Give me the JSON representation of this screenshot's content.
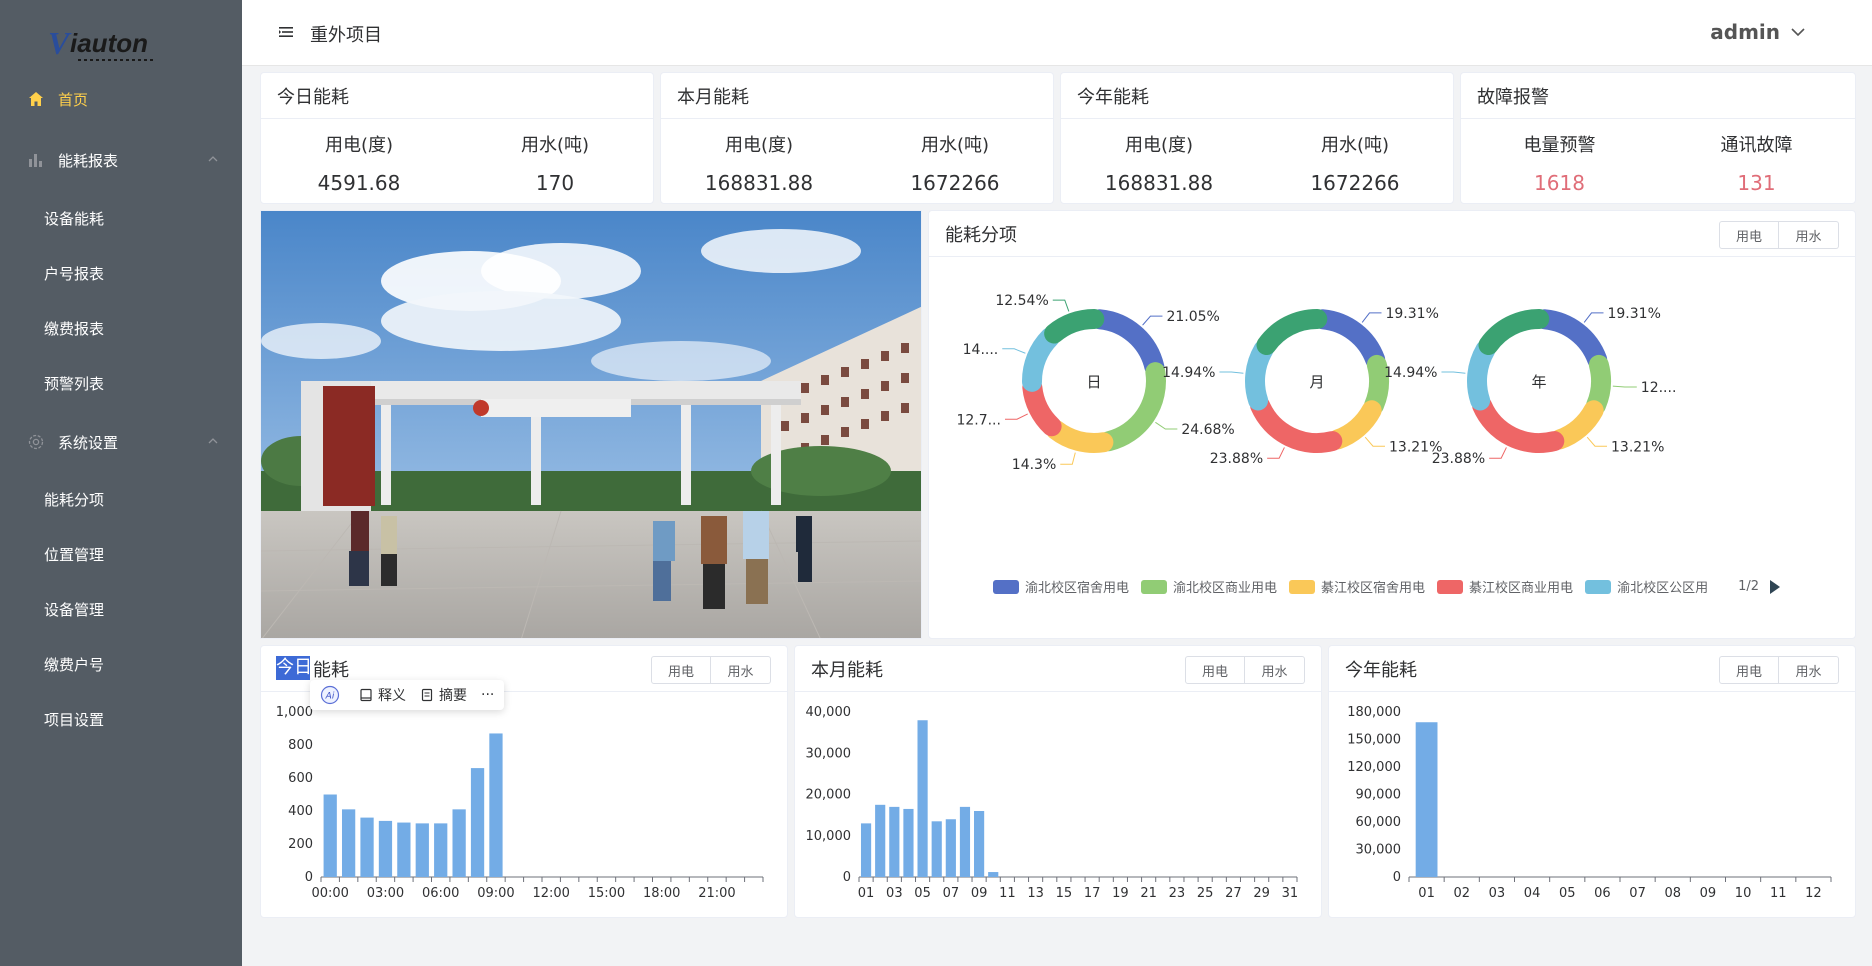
{
  "brand": {
    "logo_text": "Viauton"
  },
  "sidebar": {
    "home": "首页",
    "reports": {
      "label": "能耗报表",
      "items": [
        "设备能耗",
        "户号报表",
        "缴费报表",
        "预警列表"
      ]
    },
    "settings": {
      "label": "系统设置",
      "items": [
        "能耗分项",
        "位置管理",
        "设备管理",
        "缴费户号",
        "项目设置"
      ]
    }
  },
  "header": {
    "project": "重外项目",
    "user": "admin"
  },
  "stats": [
    {
      "title": "今日能耗",
      "labels": [
        "用电(度)",
        "用水(吨)"
      ],
      "values": [
        "4591.68",
        "170"
      ]
    },
    {
      "title": "本月能耗",
      "labels": [
        "用电(度)",
        "用水(吨)"
      ],
      "values": [
        "168831.88",
        "1672266"
      ]
    },
    {
      "title": "今年能耗",
      "labels": [
        "用电(度)",
        "用水(吨)"
      ],
      "values": [
        "168831.88",
        "1672266"
      ]
    },
    {
      "title": "故障报警",
      "labels": [
        "电量预警",
        "通讯故障"
      ],
      "values": [
        "1618",
        "131"
      ]
    }
  ],
  "toggle": {
    "elec": "用电",
    "water": "用水"
  },
  "breakdown": {
    "title": "能耗分项",
    "legend_page": "1/2",
    "legend": [
      "渝北校区宿舍用电",
      "渝北校区商业用电",
      "綦江校区宿舍用电",
      "綦江校区商业用电",
      "渝北校区公区用"
    ]
  },
  "ai_toolbar": {
    "explain": "释义",
    "summary": "摘要",
    "more": "···",
    "ai": "Ai"
  },
  "colors": {
    "blue": "#5470c6",
    "green": "#91cc75",
    "yellow": "#fac858",
    "red": "#ee6666",
    "cyan": "#73c0de",
    "teal": "#3ba272",
    "bar": "#73ace6",
    "sidebar": "#545c64",
    "active": "#ffd04b"
  },
  "chart_data": [
    {
      "type": "pie",
      "center_label": "日",
      "slices": [
        {
          "label": "渝北校区宿舍用电",
          "value": 21.05,
          "text": "21.05%"
        },
        {
          "label": "渝北校区商业用电",
          "value": 24.68,
          "text": "24.68%"
        },
        {
          "label": "綦江校区宿舍用电",
          "value": 14.3,
          "text": "14.3%"
        },
        {
          "label": "綦江校区商业用电",
          "value": 12.7,
          "text": "12.7..."
        },
        {
          "label": "渝北校区公区用",
          "value": 14.0,
          "text": "14...."
        },
        {
          "label": "",
          "value": 12.54,
          "text": "12.54%"
        }
      ]
    },
    {
      "type": "pie",
      "center_label": "月",
      "slices": [
        {
          "label": "渝北校区宿舍用电",
          "value": 19.31,
          "text": "19.31%"
        },
        {
          "label": "渝北校区商业用电",
          "value": 12.0,
          "text": ""
        },
        {
          "label": "綦江校区宿舍用电",
          "value": 13.21,
          "text": "13.21%"
        },
        {
          "label": "綦江校区商业用电",
          "value": 23.88,
          "text": "23.88%"
        },
        {
          "label": "渝北校区公区用",
          "value": 14.94,
          "text": "14.94%"
        },
        {
          "label": "",
          "value": 16.66,
          "text": ""
        }
      ]
    },
    {
      "type": "pie",
      "center_label": "年",
      "slices": [
        {
          "label": "渝北校区宿舍用电",
          "value": 19.31,
          "text": "19.31%"
        },
        {
          "label": "渝北校区商业用电",
          "value": 12.0,
          "text": "12...."
        },
        {
          "label": "綦江校区宿舍用电",
          "value": 13.21,
          "text": "13.21%"
        },
        {
          "label": "綦江校区商业用电",
          "value": 23.88,
          "text": "23.88%"
        },
        {
          "label": "渝北校区公区用",
          "value": 14.94,
          "text": "14.94%"
        },
        {
          "label": "",
          "value": 16.66,
          "text": ""
        }
      ]
    },
    {
      "type": "bar",
      "title": "今日能耗",
      "categories": [
        "00:00",
        "01:00",
        "02:00",
        "03:00",
        "04:00",
        "05:00",
        "06:00",
        "07:00",
        "08:00",
        "09:00",
        "10:00",
        "11:00",
        "12:00",
        "13:00",
        "14:00",
        "15:00",
        "16:00",
        "17:00",
        "18:00",
        "19:00",
        "20:00",
        "21:00",
        "22:00",
        "23:00"
      ],
      "tick_labels": [
        "00:00",
        "03:00",
        "06:00",
        "09:00",
        "12:00",
        "15:00",
        "18:00",
        "21:00"
      ],
      "values": [
        500,
        410,
        360,
        340,
        330,
        325,
        325,
        410,
        660,
        870,
        0,
        0,
        0,
        0,
        0,
        0,
        0,
        0,
        0,
        0,
        0,
        0,
        0,
        0
      ],
      "ylim": [
        0,
        1000
      ],
      "yticks": [
        "0",
        "200",
        "400",
        "600",
        "800",
        "1,000"
      ]
    },
    {
      "type": "bar",
      "title": "本月能耗",
      "categories": [
        "01",
        "02",
        "03",
        "04",
        "05",
        "06",
        "07",
        "08",
        "09",
        "10",
        "11",
        "12",
        "13",
        "14",
        "15",
        "16",
        "17",
        "18",
        "19",
        "20",
        "21",
        "22",
        "23",
        "24",
        "25",
        "26",
        "27",
        "28",
        "29",
        "30",
        "31"
      ],
      "tick_labels": [
        "01",
        "03",
        "05",
        "07",
        "09",
        "11",
        "13",
        "15",
        "17",
        "19",
        "21",
        "23",
        "25",
        "27",
        "29",
        "31"
      ],
      "values": [
        13000,
        17500,
        17000,
        16500,
        38000,
        13500,
        14000,
        17000,
        16000,
        1200,
        0,
        0,
        0,
        0,
        0,
        0,
        0,
        0,
        0,
        0,
        0,
        0,
        0,
        0,
        0,
        0,
        0,
        0,
        0,
        0,
        0
      ],
      "ylim": [
        0,
        40000
      ],
      "yticks": [
        "0",
        "10,000",
        "20,000",
        "30,000",
        "40,000"
      ]
    },
    {
      "type": "bar",
      "title": "今年能耗",
      "categories": [
        "01",
        "02",
        "03",
        "04",
        "05",
        "06",
        "07",
        "08",
        "09",
        "10",
        "11",
        "12"
      ],
      "tick_labels": [
        "01",
        "02",
        "03",
        "04",
        "05",
        "06",
        "07",
        "08",
        "09",
        "10",
        "11",
        "12"
      ],
      "values": [
        168832,
        0,
        0,
        0,
        0,
        0,
        0,
        0,
        0,
        0,
        0,
        0
      ],
      "ylim": [
        0,
        180000
      ],
      "yticks": [
        "0",
        "30,000",
        "60,000",
        "90,000",
        "120,000",
        "150,000",
        "180,000"
      ]
    }
  ]
}
